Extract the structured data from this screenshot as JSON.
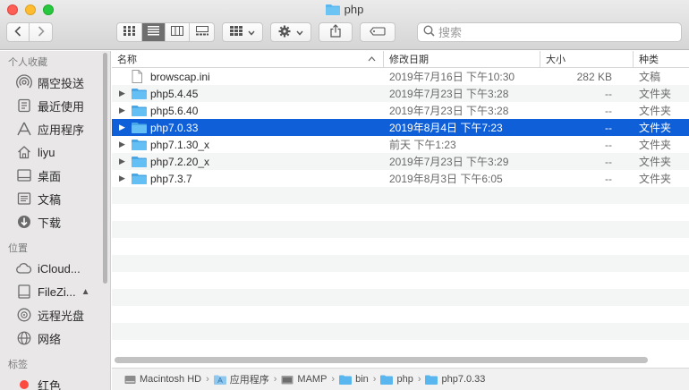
{
  "window": {
    "title": "php"
  },
  "toolbar": {
    "back_icon": "chevron-left-icon",
    "forward_icon": "chevron-right-icon",
    "view_modes": [
      "icon-view",
      "list-view",
      "column-view",
      "gallery-view"
    ],
    "active_view": "list-view",
    "search_placeholder": "搜索"
  },
  "sidebar": {
    "favorites_header": "个人收藏",
    "favorites": [
      {
        "label": "隔空投送",
        "icon": "airdrop-icon"
      },
      {
        "label": "最近使用",
        "icon": "recents-icon"
      },
      {
        "label": "应用程序",
        "icon": "applications-icon"
      },
      {
        "label": "liyu",
        "icon": "home-icon"
      },
      {
        "label": "桌面",
        "icon": "desktop-icon"
      },
      {
        "label": "文稿",
        "icon": "documents-icon"
      },
      {
        "label": "下载",
        "icon": "downloads-icon"
      }
    ],
    "locations_header": "位置",
    "locations": [
      {
        "label": "iCloud...",
        "icon": "cloud-icon"
      },
      {
        "label": "FileZi...",
        "icon": "disk-icon"
      },
      {
        "label": "远程光盘",
        "icon": "optical-disc-icon"
      },
      {
        "label": "网络",
        "icon": "network-icon"
      }
    ],
    "tags_header": "标签",
    "tags": [
      {
        "label": "红色",
        "color": "#fd4a41"
      }
    ]
  },
  "columns": {
    "name": "名称",
    "date": "修改日期",
    "size": "大小",
    "kind": "种类"
  },
  "files": [
    {
      "name": "browscap.ini",
      "date": "2019年7月16日 下午10:30",
      "size": "282 KB",
      "kind": "文稿",
      "type": "file"
    },
    {
      "name": "php5.4.45",
      "date": "2019年7月23日 下午3:28",
      "size": "--",
      "kind": "文件夹",
      "type": "folder"
    },
    {
      "name": "php5.6.40",
      "date": "2019年7月23日 下午3:28",
      "size": "--",
      "kind": "文件夹",
      "type": "folder"
    },
    {
      "name": "php7.0.33",
      "date": "2019年8月4日 下午7:23",
      "size": "--",
      "kind": "文件夹",
      "type": "folder",
      "selected": true
    },
    {
      "name": "php7.1.30_x",
      "date": "前天 下午1:23",
      "size": "--",
      "kind": "文件夹",
      "type": "folder"
    },
    {
      "name": "php7.2.20_x",
      "date": "2019年7月23日 下午3:29",
      "size": "--",
      "kind": "文件夹",
      "type": "folder"
    },
    {
      "name": "php7.3.7",
      "date": "2019年8月3日 下午6:05",
      "size": "--",
      "kind": "文件夹",
      "type": "folder"
    }
  ],
  "pathbar": [
    "Macintosh HD",
    "应用程序",
    "MAMP",
    "bin",
    "php",
    "php7.0.33"
  ],
  "colors": {
    "selection": "#0e5fd8",
    "folder": "#5ab6ef",
    "accent": "#0e5fd8"
  }
}
